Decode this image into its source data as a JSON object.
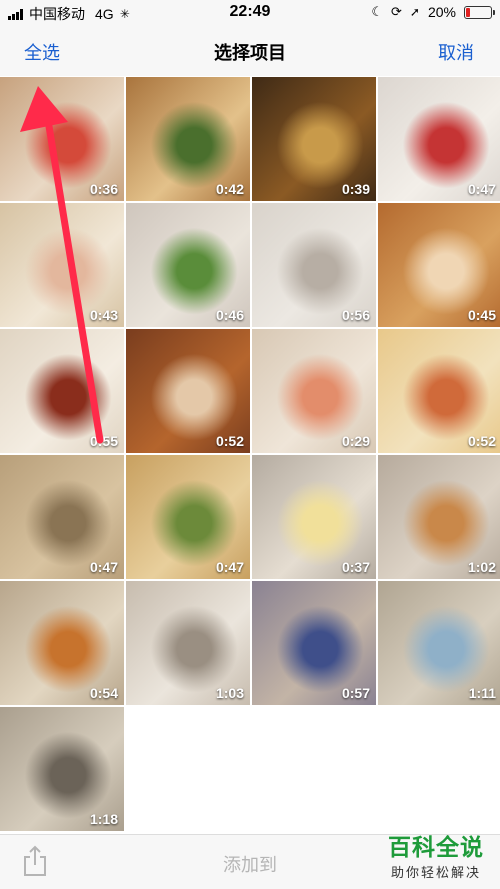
{
  "status_bar": {
    "carrier": "中国移动",
    "network": "4G",
    "time": "22:49",
    "battery": "20%",
    "battery_level": 0.2,
    "icons": [
      "signal-icon",
      "loading-icon",
      "moon-icon",
      "orientation-lock-icon",
      "location-icon",
      "battery-icon"
    ]
  },
  "nav": {
    "select_all": "全选",
    "title": "选择项目",
    "cancel": "取消"
  },
  "accent_color": "#1a5fd0",
  "thumbnails": [
    {
      "duration": "0:36",
      "bg": [
        "#c7a27e",
        "#e9d8c4",
        "#d44a3a"
      ]
    },
    {
      "duration": "0:42",
      "bg": [
        "#a9743d",
        "#e3c18a",
        "#4a6f2d"
      ]
    },
    {
      "duration": "0:39",
      "bg": [
        "#3f2a16",
        "#8b5a24",
        "#c89a4a"
      ]
    },
    {
      "duration": "0:47",
      "bg": [
        "#dcd6d0",
        "#f3efe9",
        "#c53434"
      ]
    },
    {
      "duration": "0:43",
      "bg": [
        "#d7c3a3",
        "#f1e7d6",
        "#e3b79d"
      ]
    },
    {
      "duration": "0:46",
      "bg": [
        "#cfc6bd",
        "#eae4db",
        "#5a8d3a"
      ]
    },
    {
      "duration": "0:56",
      "bg": [
        "#d9d3cb",
        "#ece8e2",
        "#b7aea4"
      ]
    },
    {
      "duration": "0:45",
      "bg": [
        "#b46a2f",
        "#d9a15f",
        "#f0d6b4"
      ]
    },
    {
      "duration": "0:55",
      "bg": [
        "#e0d4c2",
        "#f4ede2",
        "#8a2d1c"
      ]
    },
    {
      "duration": "0:52",
      "bg": [
        "#7a3d1e",
        "#b5652d",
        "#e4c8a8"
      ]
    },
    {
      "duration": "0:29",
      "bg": [
        "#d8c8b4",
        "#efe5d8",
        "#e38d6b"
      ]
    },
    {
      "duration": "0:52",
      "bg": [
        "#e8c88a",
        "#f2e2bd",
        "#d06a3a"
      ]
    },
    {
      "duration": "0:47",
      "bg": [
        "#b89f7a",
        "#d8c3a0",
        "#8a7454"
      ]
    },
    {
      "duration": "0:47",
      "bg": [
        "#c8a060",
        "#e8cf9c",
        "#6c8a3a"
      ]
    },
    {
      "duration": "0:37",
      "bg": [
        "#b4aba0",
        "#e5ddd1",
        "#f1e09a"
      ]
    },
    {
      "duration": "1:02",
      "bg": [
        "#b6aa9c",
        "#ddd3c6",
        "#c9884a"
      ]
    },
    {
      "duration": "0:54",
      "bg": [
        "#b8a68c",
        "#e2d6c1",
        "#c7732d"
      ]
    },
    {
      "duration": "1:03",
      "bg": [
        "#c7bcae",
        "#ebe5dc",
        "#9a8f82"
      ]
    },
    {
      "duration": "0:57",
      "bg": [
        "#8a8292",
        "#c3b4a6",
        "#3f4f8a"
      ]
    },
    {
      "duration": "1:11",
      "bg": [
        "#b0a592",
        "#d8cfbf",
        "#8fb0c8"
      ]
    },
    {
      "duration": "1:18",
      "bg": [
        "#aa9f8e",
        "#d6cdbd",
        "#6b6358"
      ]
    }
  ],
  "toolbar": {
    "add_to": "添加到",
    "share_icon": "share-icon"
  },
  "watermark": {
    "main": "百科全说",
    "sub": "助你轻松解决"
  }
}
